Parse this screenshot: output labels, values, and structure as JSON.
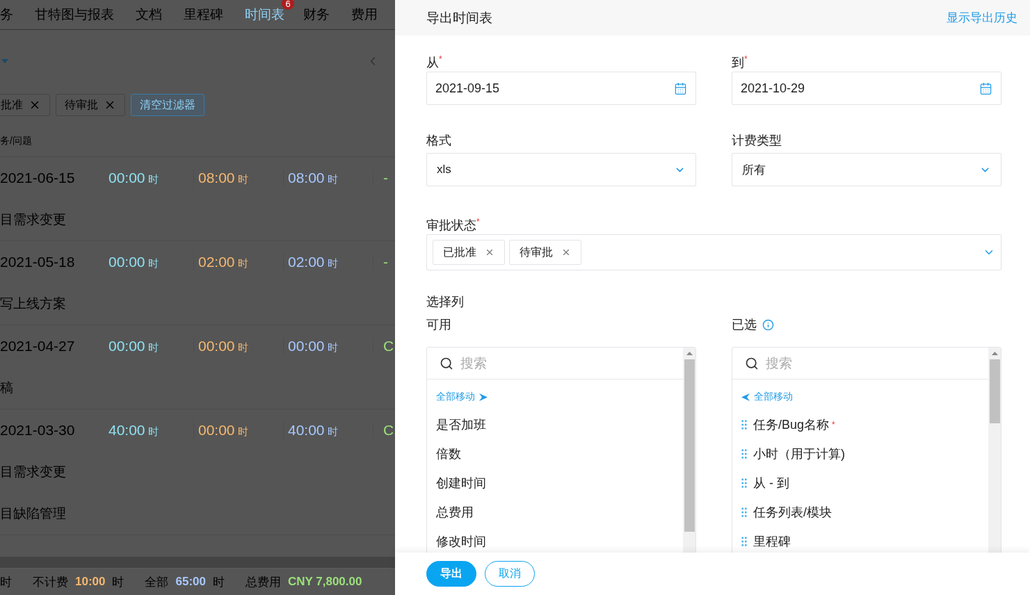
{
  "background": {
    "nav_tabs": [
      {
        "label": "务",
        "selected": false
      },
      {
        "label": "甘特图与报表",
        "selected": false
      },
      {
        "label": "文档",
        "selected": false
      },
      {
        "label": "里程碑",
        "selected": false
      },
      {
        "label": "时间表",
        "selected": true,
        "badge": "6"
      },
      {
        "label": "财务",
        "selected": false
      },
      {
        "label": "费用",
        "selected": false
      }
    ],
    "filter_chips": [
      {
        "label": "批准",
        "kind": "chip"
      },
      {
        "label": "待审批",
        "kind": "chip"
      },
      {
        "label": "清空过滤器",
        "kind": "clear"
      }
    ],
    "column_header": "务/问题",
    "rows": [
      {
        "kind": "entry",
        "date": "2021-06-15",
        "times": [
          {
            "value": "00:00",
            "unit": "时"
          },
          {
            "value": "08:00",
            "unit": "时"
          },
          {
            "value": "08:00",
            "unit": "时"
          }
        ],
        "tail": "-"
      },
      {
        "kind": "task",
        "name": "目需求变更"
      },
      {
        "kind": "entry",
        "date": "2021-05-18",
        "times": [
          {
            "value": "00:00",
            "unit": "时"
          },
          {
            "value": "02:00",
            "unit": "时"
          },
          {
            "value": "02:00",
            "unit": "时"
          }
        ],
        "tail": "-"
      },
      {
        "kind": "task",
        "name": "写上线方案"
      },
      {
        "kind": "entry",
        "date": "2021-04-27",
        "times": [
          {
            "value": "00:00",
            "unit": "时"
          },
          {
            "value": "00:00",
            "unit": "时"
          },
          {
            "value": "00:00",
            "unit": "时"
          }
        ],
        "tail": "C"
      },
      {
        "kind": "task",
        "name": "稿"
      },
      {
        "kind": "entry",
        "date": "2021-03-30",
        "times": [
          {
            "value": "40:00",
            "unit": "时"
          },
          {
            "value": "00:00",
            "unit": "时"
          },
          {
            "value": "40:00",
            "unit": "时"
          }
        ],
        "tail": "C"
      },
      {
        "kind": "task",
        "name": "目需求变更"
      },
      {
        "kind": "task",
        "name": "目缺陷管理"
      }
    ],
    "footer": [
      {
        "unit": "时"
      },
      {
        "label": "不计费",
        "value": "10:00",
        "unit": "时"
      },
      {
        "label": "全部",
        "value": "65:00",
        "unit": "时"
      },
      {
        "label": "总费用",
        "value": "CNY 7,800.00"
      }
    ]
  },
  "panel": {
    "title": "导出时间表",
    "history_link": "显示导出历史",
    "required_mark": "*",
    "from": {
      "label": "从",
      "value": "2021-09-15"
    },
    "to": {
      "label": "到",
      "value": "2021-10-29"
    },
    "format": {
      "label": "格式",
      "value": "xls"
    },
    "billing_type": {
      "label": "计费类型",
      "value": "所有"
    },
    "approval": {
      "label": "审批状态",
      "tags": [
        "已批准",
        "待审批"
      ]
    },
    "columns": {
      "title": "选择列",
      "available": {
        "label": "可用",
        "search_placeholder": "搜索",
        "move_all": "全部移动",
        "items": [
          "是否加班",
          "倍数",
          "创建时间",
          "总费用",
          "修改时间"
        ]
      },
      "selected": {
        "label": "已选",
        "search_placeholder": "搜索",
        "move_all": "全部移动",
        "items": [
          {
            "label": "任务/Bug名称",
            "required": true
          },
          {
            "label": "小时（用于计算)",
            "required": false
          },
          {
            "label": "从 - 到",
            "required": false
          },
          {
            "label": "任务列表/模块",
            "required": false
          },
          {
            "label": "里程碑",
            "required": false
          }
        ]
      }
    },
    "buttons": [
      {
        "label": "导出",
        "kind": "primary"
      },
      {
        "label": "取消",
        "kind": "secondary"
      }
    ]
  }
}
